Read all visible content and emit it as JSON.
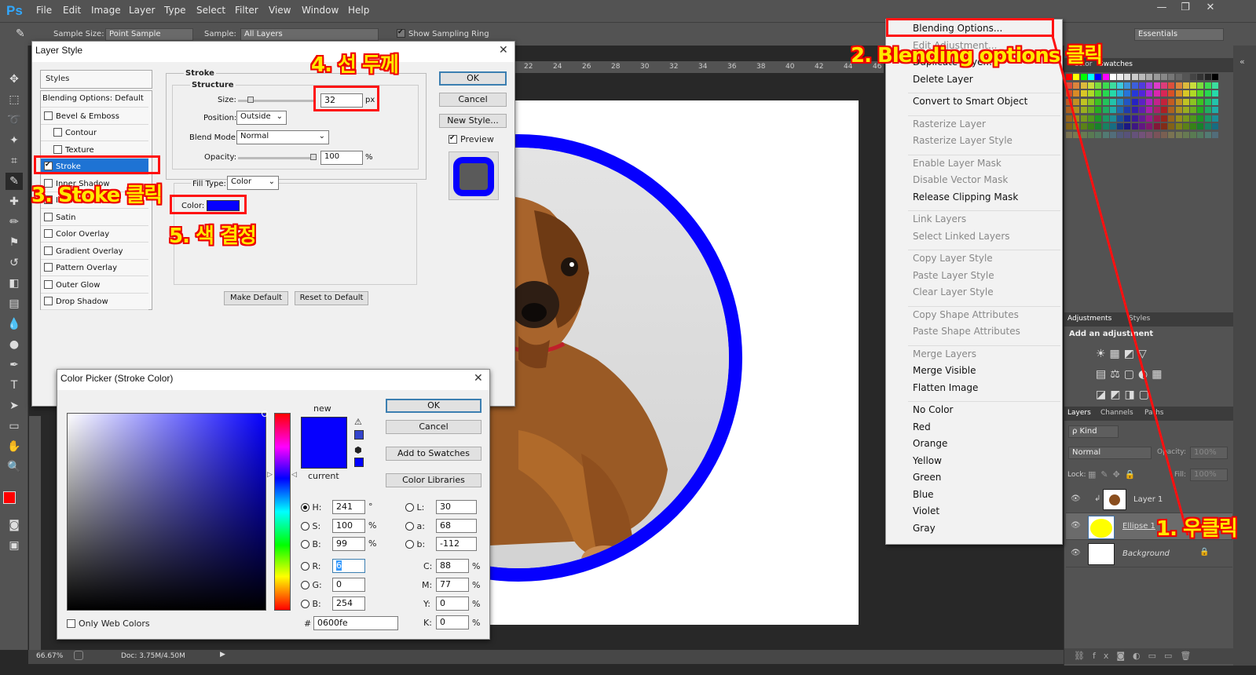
{
  "app": {
    "logo": "Ps"
  },
  "menu": [
    "File",
    "Edit",
    "Image",
    "Layer",
    "Type",
    "Select",
    "Filter",
    "View",
    "Window",
    "Help"
  ],
  "window_controls": {
    "minimize": "—",
    "restore": "❐",
    "close": "✕"
  },
  "options_bar": {
    "sample_size_label": "Sample Size:",
    "sample_size_value": "Point Sample",
    "sample_label": "Sample:",
    "sample_value": "All Layers",
    "show_ring_label": "Show Sampling Ring",
    "workspace": "Essentials"
  },
  "ruler_ticks": [
    "22",
    "24",
    "26",
    "28",
    "30",
    "32",
    "34",
    "36",
    "38",
    "40",
    "42",
    "44",
    "46"
  ],
  "ruler_left": [
    "2",
    "2",
    "4",
    "2",
    "6",
    "2",
    "8",
    "3",
    "0",
    "3",
    "2",
    "3",
    "4"
  ],
  "status": {
    "zoom": "66.67%",
    "doc": "Doc: 3.75M/4.50M"
  },
  "layer_style": {
    "title": "Layer Style",
    "styles_header": "Styles",
    "items": [
      {
        "label": "Blending Options: Default",
        "cb": false,
        "indent": false,
        "selected": false,
        "checked": false
      },
      {
        "label": "Bevel & Emboss",
        "cb": true,
        "indent": false,
        "selected": false,
        "checked": false
      },
      {
        "label": "Contour",
        "cb": true,
        "indent": true,
        "selected": false,
        "checked": false
      },
      {
        "label": "Texture",
        "cb": true,
        "indent": true,
        "selected": false,
        "checked": false
      },
      {
        "label": "Stroke",
        "cb": true,
        "indent": false,
        "selected": true,
        "checked": true
      },
      {
        "label": "Inner Shadow",
        "cb": true,
        "indent": false,
        "selected": false,
        "checked": false
      },
      {
        "label": "Inner Glow",
        "cb": true,
        "indent": false,
        "selected": false,
        "checked": false
      },
      {
        "label": "Satin",
        "cb": true,
        "indent": false,
        "selected": false,
        "checked": false
      },
      {
        "label": "Color Overlay",
        "cb": true,
        "indent": false,
        "selected": false,
        "checked": false
      },
      {
        "label": "Gradient Overlay",
        "cb": true,
        "indent": false,
        "selected": false,
        "checked": false
      },
      {
        "label": "Pattern Overlay",
        "cb": true,
        "indent": false,
        "selected": false,
        "checked": false
      },
      {
        "label": "Outer Glow",
        "cb": true,
        "indent": false,
        "selected": false,
        "checked": false
      },
      {
        "label": "Drop Shadow",
        "cb": true,
        "indent": false,
        "selected": false,
        "checked": false
      }
    ],
    "stroke_heading": "Stroke",
    "structure_heading": "Structure",
    "size_label": "Size:",
    "size_value": "32",
    "size_unit": "px",
    "position_label": "Position:",
    "position_value": "Outside",
    "blend_label": "Blend Mode:",
    "blend_value": "Normal",
    "opacity_label": "Opacity:",
    "opacity_value": "100",
    "opacity_unit": "%",
    "fill_type_label": "Fill Type:",
    "fill_type_value": "Color",
    "color_label": "Color:",
    "stroke_color": "#0600fe",
    "make_default": "Make Default",
    "reset_default": "Reset to Default",
    "ok": "OK",
    "cancel": "Cancel",
    "new_style": "New Style...",
    "preview": "Preview"
  },
  "color_picker": {
    "title": "Color Picker (Stroke Color)",
    "new_label": "new",
    "current_label": "current",
    "new_color": "#0600fe",
    "current_color": "#0600fe",
    "ok": "OK",
    "cancel": "Cancel",
    "add_swatches": "Add to Swatches",
    "color_libraries": "Color Libraries",
    "fields": {
      "H": "241",
      "H_unit": "°",
      "S": "100",
      "S_unit": "%",
      "B": "99",
      "B_unit": "%",
      "R": "6",
      "G": "0",
      "B2": "254",
      "L": "30",
      "a": "68",
      "b": "-112",
      "C": "88",
      "M": "77",
      "Y": "0",
      "K": "0",
      "pct": "%",
      "hex_label": "#",
      "hex": "0600fe"
    },
    "labels": {
      "H": "H:",
      "S": "S:",
      "B": "B:",
      "R": "R:",
      "G": "G:",
      "B2": "B:",
      "L": "L:",
      "a": "a:",
      "b": "b:",
      "C": "C:",
      "M": "M:",
      "Y": "Y:",
      "K": "K:"
    },
    "web_only": "Only Web Colors"
  },
  "context_menu": [
    {
      "label": "Blending Options...",
      "disabled": false
    },
    {
      "label": "Edit Adjustment...",
      "disabled": true
    },
    {
      "label": "Duplicate Layer...",
      "disabled": false
    },
    {
      "label": "Delete Layer",
      "disabled": false
    },
    {
      "sep": true
    },
    {
      "label": "Convert to Smart Object",
      "disabled": false
    },
    {
      "sep": true
    },
    {
      "label": "Rasterize Layer",
      "disabled": true
    },
    {
      "label": "Rasterize Layer Style",
      "disabled": true
    },
    {
      "sep": true
    },
    {
      "label": "Enable Layer Mask",
      "disabled": true
    },
    {
      "label": "Disable Vector Mask",
      "disabled": true
    },
    {
      "label": "Release Clipping Mask",
      "disabled": false
    },
    {
      "sep": true
    },
    {
      "label": "Link Layers",
      "disabled": true
    },
    {
      "label": "Select Linked Layers",
      "disabled": true
    },
    {
      "sep": true
    },
    {
      "label": "Copy Layer Style",
      "disabled": true
    },
    {
      "label": "Paste Layer Style",
      "disabled": true
    },
    {
      "label": "Clear Layer Style",
      "disabled": true
    },
    {
      "sep": true
    },
    {
      "label": "Copy Shape Attributes",
      "disabled": true
    },
    {
      "label": "Paste Shape Attributes",
      "disabled": true
    },
    {
      "sep": true
    },
    {
      "label": "Merge Layers",
      "disabled": true
    },
    {
      "label": "Merge Visible",
      "disabled": false
    },
    {
      "label": "Flatten Image",
      "disabled": false
    },
    {
      "sep": true
    },
    {
      "label": "No Color",
      "disabled": false
    },
    {
      "label": "Red",
      "disabled": false
    },
    {
      "label": "Orange",
      "disabled": false
    },
    {
      "label": "Yellow",
      "disabled": false
    },
    {
      "label": "Green",
      "disabled": false
    },
    {
      "label": "Blue",
      "disabled": false
    },
    {
      "label": "Violet",
      "disabled": false
    },
    {
      "label": "Gray",
      "disabled": false
    }
  ],
  "panels": {
    "color_tab": "Color",
    "swatches_tab": "Swatches",
    "adjustments_tab": "Adjustments",
    "styles_tab": "Styles",
    "add_adjustment": "Add an adjustment",
    "layers_tab": "Layers",
    "channels_tab": "Channels",
    "paths_tab": "Paths",
    "kind": "ρ Kind",
    "blend": "Normal",
    "opacity_label": "Opacity:",
    "opacity_value": "100%",
    "lock_label": "Lock:",
    "fill_label": "Fill:",
    "fill_value": "100%",
    "layers": [
      {
        "name": "Layer 1",
        "thumb": "dog"
      },
      {
        "name": "Ellipse 1",
        "thumb": "yellow"
      },
      {
        "name": "Background",
        "thumb": "white"
      }
    ]
  },
  "annotations": {
    "a1": "1. 우클릭",
    "a2": "2. Blending options 클릭",
    "a3": "3. Stoke 클릭",
    "a4": "4. 선 두께",
    "a5": "5. 색 결정"
  },
  "colors": {
    "annotation_outline": "#ff1010",
    "annotation_fill": "#ffe800",
    "stroke_blue": "#0600fe",
    "ui_dark": "#535353"
  }
}
